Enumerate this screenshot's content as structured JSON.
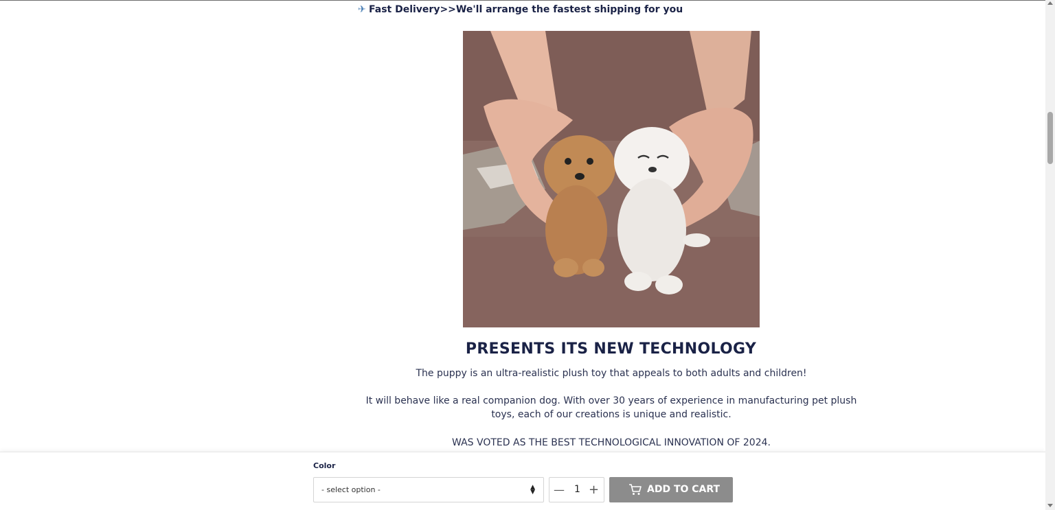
{
  "announcement": {
    "icon": "airplane-icon",
    "text": "Fast Delivery>>We'll arrange the fastest shipping for you"
  },
  "product_image": {
    "subject": "two-puppies-photo"
  },
  "content": {
    "headline": "PRESENTS ITS NEW TECHNOLOGY",
    "paragraph_1": "The puppy is an ultra-realistic plush toy that appeals to both adults and children!",
    "paragraph_2": "It will behave like a real companion dog. With over 30 years of experience in manufacturing pet plush toys, each of our creations is unique and realistic.",
    "paragraph_3": "WAS VOTED AS THE BEST TECHNOLOGICAL INNOVATION OF 2024."
  },
  "purchase_bar": {
    "color_label": "Color",
    "select_value": "- select option -",
    "quantity": "1",
    "minus_symbol": "—",
    "plus_symbol": "+",
    "add_to_cart_label": "ADD TO CART"
  },
  "colors": {
    "text_dark": "#1a2246",
    "button_bg": "#8c8c8c"
  }
}
